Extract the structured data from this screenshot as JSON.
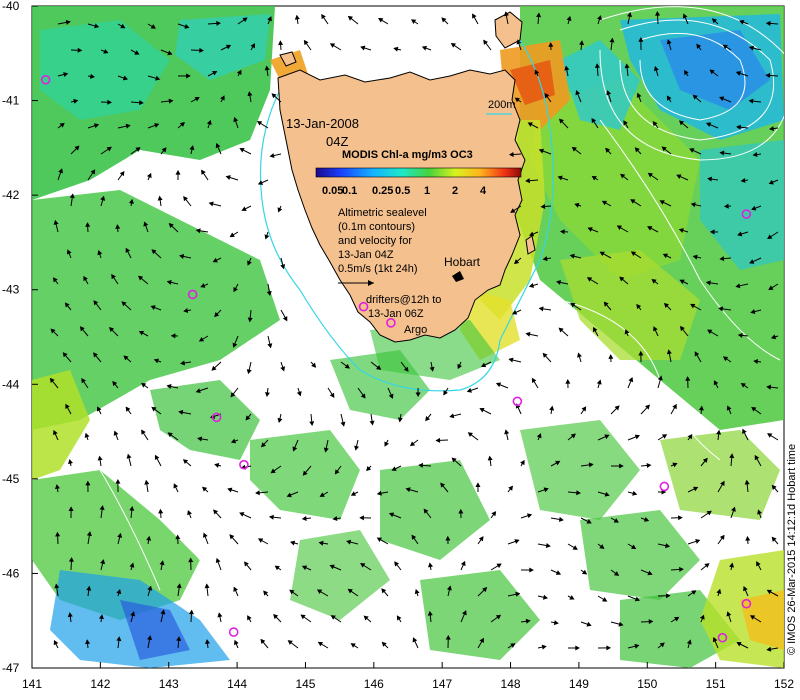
{
  "title_date": "13-Jan-2008",
  "title_time": "04Z",
  "depth_label": "200m",
  "colorbar": {
    "title": "MODIS Chl-a mg/m3 OC3",
    "ticks": [
      "0.05",
      "0.1",
      "0.25",
      "0.5",
      "1",
      "2",
      "4"
    ]
  },
  "legend": {
    "line1": "Altimetric sealevel",
    "line2": "(0.1m contours)",
    "line3": "and velocity for",
    "line4": "13-Jan 04Z",
    "line5": "0.5m/s (1kt 24h)",
    "drifters1": "drifters@12h to",
    "drifters2": "13-Jan 06Z",
    "argo": "Argo"
  },
  "place": "Hobart",
  "credit": "© IMOS 26-Mar-2015 14:12:1d Hobart time",
  "axes": {
    "x_ticks": [
      "141",
      "142",
      "143",
      "144",
      "145",
      "146",
      "147",
      "148",
      "149",
      "150",
      "151",
      "152"
    ],
    "y_ticks": [
      "-40",
      "-41",
      "-42",
      "-43",
      "-44",
      "-45",
      "-46",
      "-47"
    ],
    "lon_range": [
      141,
      152
    ],
    "lat_range": [
      -47,
      -40
    ]
  },
  "colors": {
    "land": "#f4c08e",
    "contour_200m": "#33d6e6",
    "argo": "#e020e0"
  },
  "argo_floats": [
    [
      141.2,
      -40.78
    ],
    [
      143.35,
      -43.05
    ],
    [
      143.7,
      -44.35
    ],
    [
      144.1,
      -44.85
    ],
    [
      143.95,
      -46.62
    ],
    [
      146.25,
      -43.35
    ],
    [
      145.85,
      -43.18
    ],
    [
      148.1,
      -44.18
    ],
    [
      150.25,
      -45.08
    ],
    [
      151.45,
      -42.2
    ],
    [
      151.45,
      -46.32
    ],
    [
      151.1,
      -46.68
    ]
  ]
}
